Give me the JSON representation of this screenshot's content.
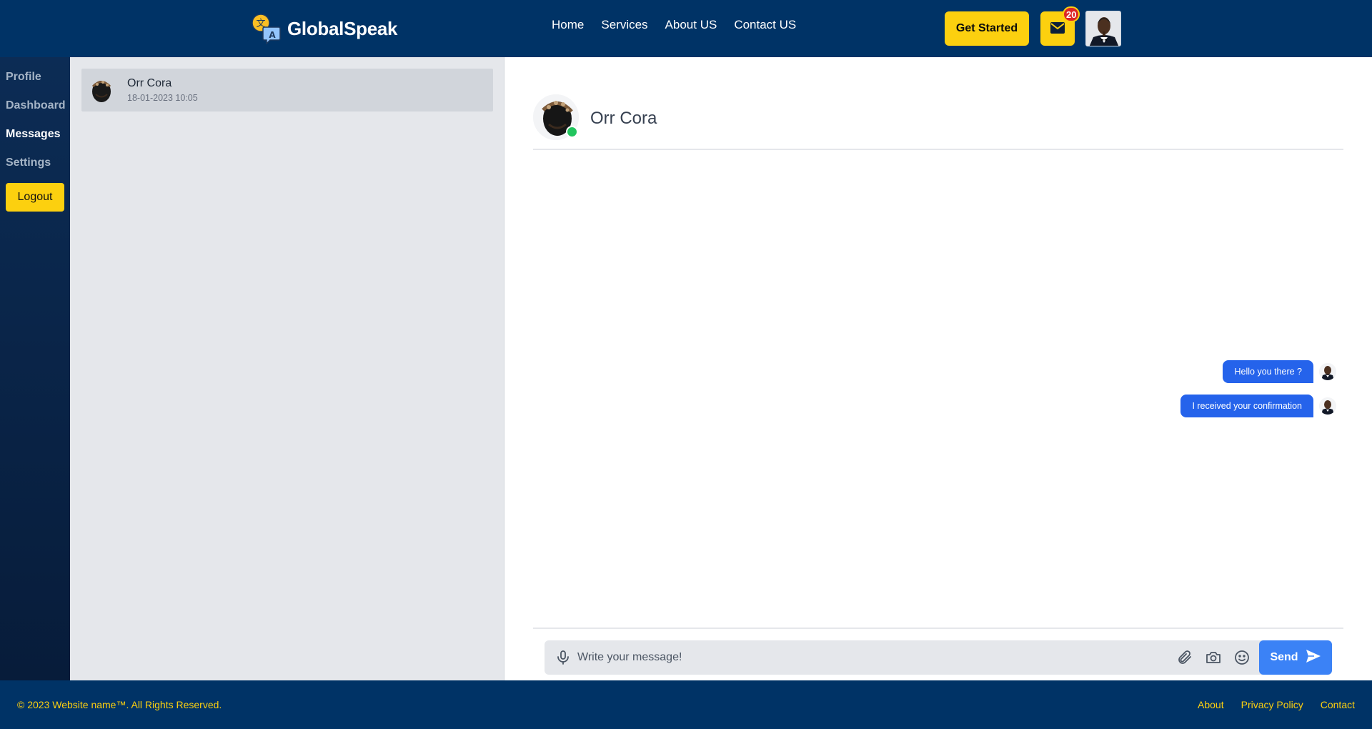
{
  "brand": {
    "name": "GlobalSpeak"
  },
  "nav": {
    "items": [
      "Home",
      "Services",
      "About US",
      "Contact US"
    ]
  },
  "header": {
    "cta_label": "Get Started",
    "mail_badge": "20"
  },
  "sidebar": {
    "items": [
      {
        "label": "Profile",
        "active": false
      },
      {
        "label": "Dashboard",
        "active": false
      },
      {
        "label": "Messages",
        "active": true
      },
      {
        "label": "Settings",
        "active": false
      }
    ],
    "logout_label": "Logout"
  },
  "conversations": [
    {
      "name": "Orr Cora",
      "timestamp": "18-01-2023 10:05"
    }
  ],
  "chat": {
    "contact_name": "Orr Cora",
    "status": "online",
    "messages": [
      {
        "text": "Hello you there ?"
      },
      {
        "text": "I received your confirmation"
      }
    ]
  },
  "composer": {
    "placeholder": "Write your message!",
    "send_label": "Send"
  },
  "footer": {
    "copyright": "© 2023 Website name™. All Rights Reserved.",
    "links": [
      "About",
      "Privacy Policy",
      "Contact"
    ]
  },
  "colors": {
    "header_bg": "#003366",
    "accent_yellow": "#fcd00f",
    "send_blue": "#3b82f6",
    "bubble_blue": "#2563eb",
    "online_green": "#22c55e",
    "badge_red": "#dc2626"
  },
  "icons": [
    "translate-logo-icon",
    "mail-icon",
    "microphone-icon",
    "paperclip-icon",
    "camera-icon",
    "emoji-icon",
    "send-arrow-icon"
  ]
}
